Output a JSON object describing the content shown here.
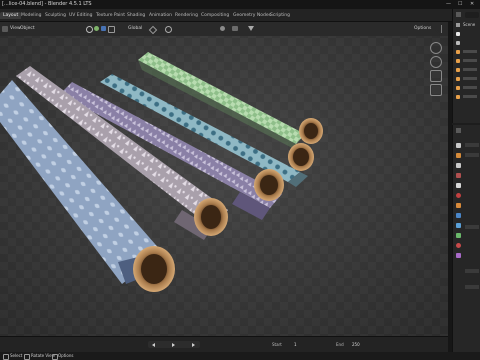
{
  "window": {
    "title": "[...lice-04.blend] - Blender 4.5.1 LTS",
    "controls": [
      "—",
      "☐",
      "✕"
    ]
  },
  "workspaces": [
    "Layout",
    "Modeling",
    "Sculpting",
    "UV Editing",
    "Texture Paint",
    "Shading",
    "Animation",
    "Rendering",
    "Compositing",
    "Geometry Nodes",
    "Scripting"
  ],
  "active_workspace": "Layout",
  "viewport": {
    "menu": [
      "View",
      "Object"
    ],
    "orientation": "Global",
    "options_label": "Options"
  },
  "outliner": {
    "scene_label": "Scene"
  },
  "timeline": {
    "start_label": "Start",
    "start_value": "1",
    "end_label": "End",
    "end_value": "250"
  },
  "statusbar": {
    "items": [
      "Select",
      "Rotate View",
      "Options"
    ]
  },
  "colors": {
    "accent": "#4772b3",
    "background": "#3a3a3a",
    "panel": "#262626"
  }
}
